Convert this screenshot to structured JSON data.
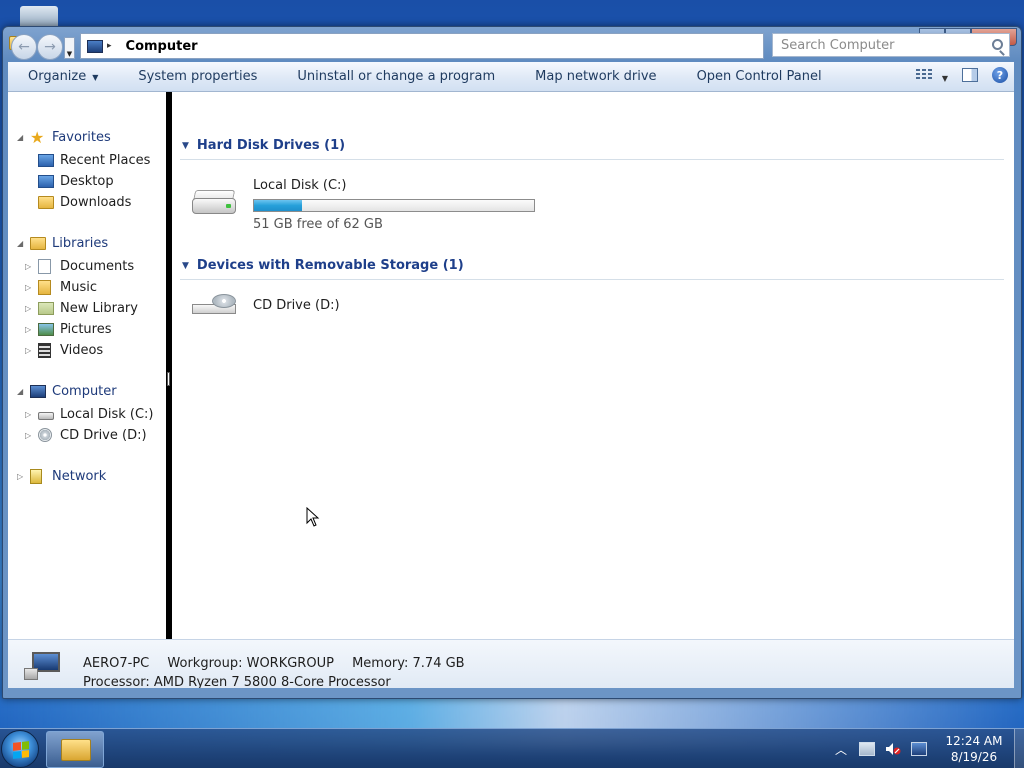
{
  "window": {
    "caption_min": "–",
    "caption_max": "□",
    "caption_close": "✕"
  },
  "address": {
    "location": "Computer",
    "separator": "▸"
  },
  "search": {
    "placeholder": "Search Computer"
  },
  "toolbar": {
    "organize": "Organize",
    "system_properties": "System properties",
    "uninstall": "Uninstall or change a program",
    "map_drive": "Map network drive",
    "control_panel": "Open Control Panel",
    "help": "?"
  },
  "nav": {
    "favorites": "Favorites",
    "recent_places": "Recent Places",
    "desktop": "Desktop",
    "downloads": "Downloads",
    "libraries": "Libraries",
    "documents": "Documents",
    "music": "Music",
    "new_library": "New Library",
    "pictures": "Pictures",
    "videos": "Videos",
    "computer": "Computer",
    "local_disk": "Local Disk (C:)",
    "cd_drive": "CD Drive (D:)",
    "network": "Network"
  },
  "content": {
    "hdd_section": "Hard Disk Drives (1)",
    "removable_section": "Devices with Removable Storage (1)",
    "drive_c": {
      "name": "Local Disk (C:)",
      "free_text": "51 GB free of 62 GB",
      "used_fraction": 0.17,
      "bar_color": "#26a0da"
    },
    "drive_d": {
      "name": "CD Drive (D:)"
    }
  },
  "details": {
    "pc_name": "AERO7-PC",
    "workgroup": "Workgroup: WORKGROUP",
    "memory": "Memory: 7.74 GB",
    "processor": "Processor: AMD Ryzen 7 5800 8-Core Processor"
  },
  "taskbar": {
    "tray_up": "︿",
    "time": "12:24 AM",
    "date": "8/19/26"
  },
  "colors": {
    "accent_link": "#1e3f8a",
    "desktop": "#1e63c4"
  }
}
